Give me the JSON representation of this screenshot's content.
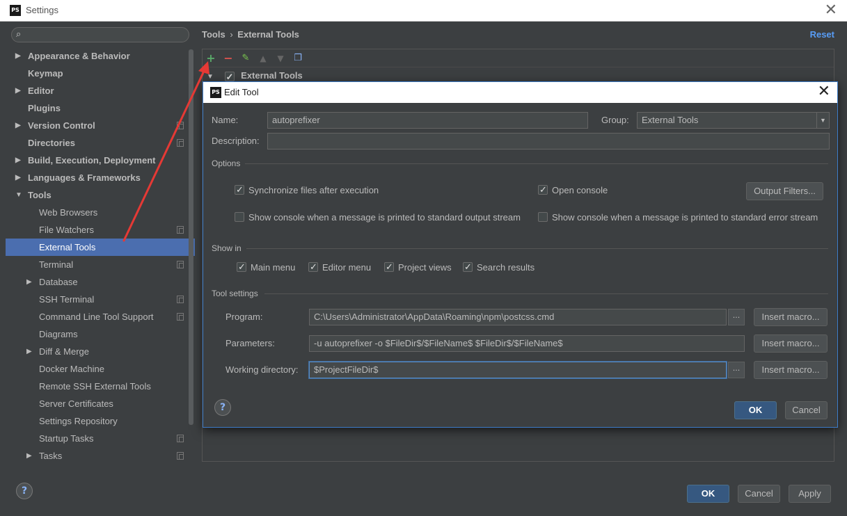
{
  "window": {
    "title": "Settings",
    "logo": "PS"
  },
  "search": {
    "placeholder": ""
  },
  "sidebar": {
    "items": [
      {
        "label": "Appearance & Behavior",
        "level": 0,
        "expandable": true,
        "expanded": false
      },
      {
        "label": "Keymap",
        "level": 0
      },
      {
        "label": "Editor",
        "level": 0,
        "expandable": true,
        "expanded": false
      },
      {
        "label": "Plugins",
        "level": 0
      },
      {
        "label": "Version Control",
        "level": 0,
        "expandable": true,
        "expanded": false,
        "project_icon": true
      },
      {
        "label": "Directories",
        "level": 0,
        "project_icon": true
      },
      {
        "label": "Build, Execution, Deployment",
        "level": 0,
        "expandable": true,
        "expanded": false
      },
      {
        "label": "Languages & Frameworks",
        "level": 0,
        "expandable": true,
        "expanded": false
      },
      {
        "label": "Tools",
        "level": 0,
        "expandable": true,
        "expanded": true
      },
      {
        "label": "Web Browsers",
        "level": 1
      },
      {
        "label": "File Watchers",
        "level": 1,
        "project_icon": true
      },
      {
        "label": "External Tools",
        "level": 1,
        "selected": true
      },
      {
        "label": "Terminal",
        "level": 1,
        "project_icon": true
      },
      {
        "label": "Database",
        "level": 1,
        "expandable": true,
        "expanded": false
      },
      {
        "label": "SSH Terminal",
        "level": 1,
        "project_icon": true
      },
      {
        "label": "Command Line Tool Support",
        "level": 1,
        "project_icon": true
      },
      {
        "label": "Diagrams",
        "level": 1
      },
      {
        "label": "Diff & Merge",
        "level": 1,
        "expandable": true,
        "expanded": false
      },
      {
        "label": "Docker Machine",
        "level": 1
      },
      {
        "label": "Remote SSH External Tools",
        "level": 1
      },
      {
        "label": "Server Certificates",
        "level": 1
      },
      {
        "label": "Settings Repository",
        "level": 1
      },
      {
        "label": "Startup Tasks",
        "level": 1,
        "project_icon": true
      },
      {
        "label": "Tasks",
        "level": 1,
        "expandable": true,
        "expanded": false,
        "project_icon": true
      }
    ]
  },
  "main": {
    "breadcrumb": {
      "parent": "Tools",
      "separator": "›",
      "current": "External Tools"
    },
    "reset_label": "Reset",
    "group_row_label": "External Tools"
  },
  "footer": {
    "ok_label": "OK",
    "cancel_label": "Cancel",
    "apply_label": "Apply",
    "help_label": "?"
  },
  "edit_tool": {
    "title": "Edit Tool",
    "name_label": "Name:",
    "name_value": "autoprefixer",
    "group_label": "Group:",
    "group_value": "External Tools",
    "description_label": "Description:",
    "description_value": "",
    "options_title": "Options",
    "sync_files_label": "Synchronize files after execution",
    "open_console_label": "Open console",
    "output_filters_label": "Output Filters...",
    "show_console_stdout_label": "Show console when a message is printed to standard output stream",
    "show_console_stderr_label": "Show console when a message is printed to standard error stream",
    "show_in_title": "Show in",
    "main_menu_label": "Main menu",
    "editor_menu_label": "Editor menu",
    "project_views_label": "Project views",
    "search_results_label": "Search results",
    "tool_settings_title": "Tool settings",
    "program_label": "Program:",
    "program_value": "C:\\Users\\Administrator\\AppData\\Roaming\\npm\\postcss.cmd",
    "parameters_label": "Parameters:",
    "parameters_value": "-u autoprefixer -o $FileDir$/$FileName$ $FileDir$/$FileName$",
    "working_dir_label": "Working directory:",
    "working_dir_value": "$ProjectFileDir$",
    "browse_label": "...",
    "insert_macro_label": "Insert macro...",
    "ok_label": "OK",
    "cancel_label": "Cancel",
    "help_label": "?"
  },
  "colors": {
    "accent": "#4b6eaf",
    "annotation": "#e53935",
    "add": "#59a869",
    "remove": "#d9534f"
  }
}
